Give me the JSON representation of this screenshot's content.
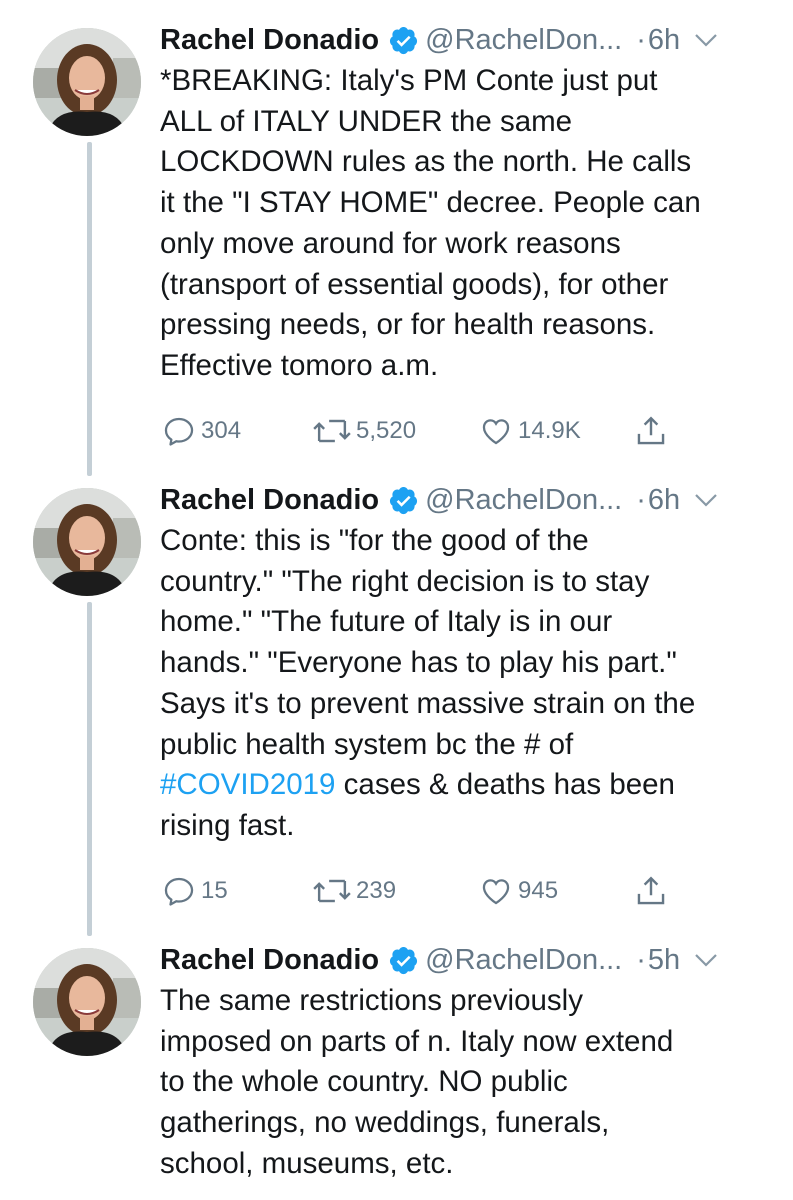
{
  "tweets": [
    {
      "name": "Rachel Donadio",
      "handle": "@RachelDon...",
      "dot": "·",
      "time": "6h",
      "text": "*BREAKING: Italy's PM Conte just put\nALL of ITALY UNDER the same\nLOCKDOWN rules as the north. He calls\nit the \"I STAY HOME\" decree. People can\nonly move around for work reasons\n(transport of essential goods), for other\npressing needs, or for health reasons.\nEffective tomoro a.m.",
      "replies": "304",
      "retweets": "5,520",
      "likes": "14.9K"
    },
    {
      "name": "Rachel Donadio",
      "handle": "@RachelDon...",
      "dot": "·",
      "time": "6h",
      "text_before": "Conte: this is \"for the good of the\ncountry.\" \"The right decision is to stay\nhome.\" \"The future of Italy is in our\nhands.\" \"Everyone has to play his part.\"\nSays it's to prevent massive strain on the\npublic health system bc the # of\n",
      "hashtag": "#COVID2019",
      "text_after": " cases & deaths has been\nrising fast.",
      "replies": "15",
      "retweets": "239",
      "likes": "945"
    },
    {
      "name": "Rachel Donadio",
      "handle": "@RachelDon...",
      "dot": "·",
      "time": "5h",
      "text": "The same restrictions previously\nimposed on parts of n. Italy now extend\nto the whole country. NO public\ngatherings, no weddings, funerals,\nschool, museums, etc."
    }
  ],
  "colors": {
    "accent": "#1da1f2",
    "secondary_text": "#657786",
    "thread_line": "#c4cfd6"
  },
  "icons": {
    "reply": "reply-icon",
    "retweet": "retweet-icon",
    "like": "heart-icon",
    "share": "share-icon",
    "verified": "verified-badge-icon",
    "menu": "chevron-down-icon"
  }
}
